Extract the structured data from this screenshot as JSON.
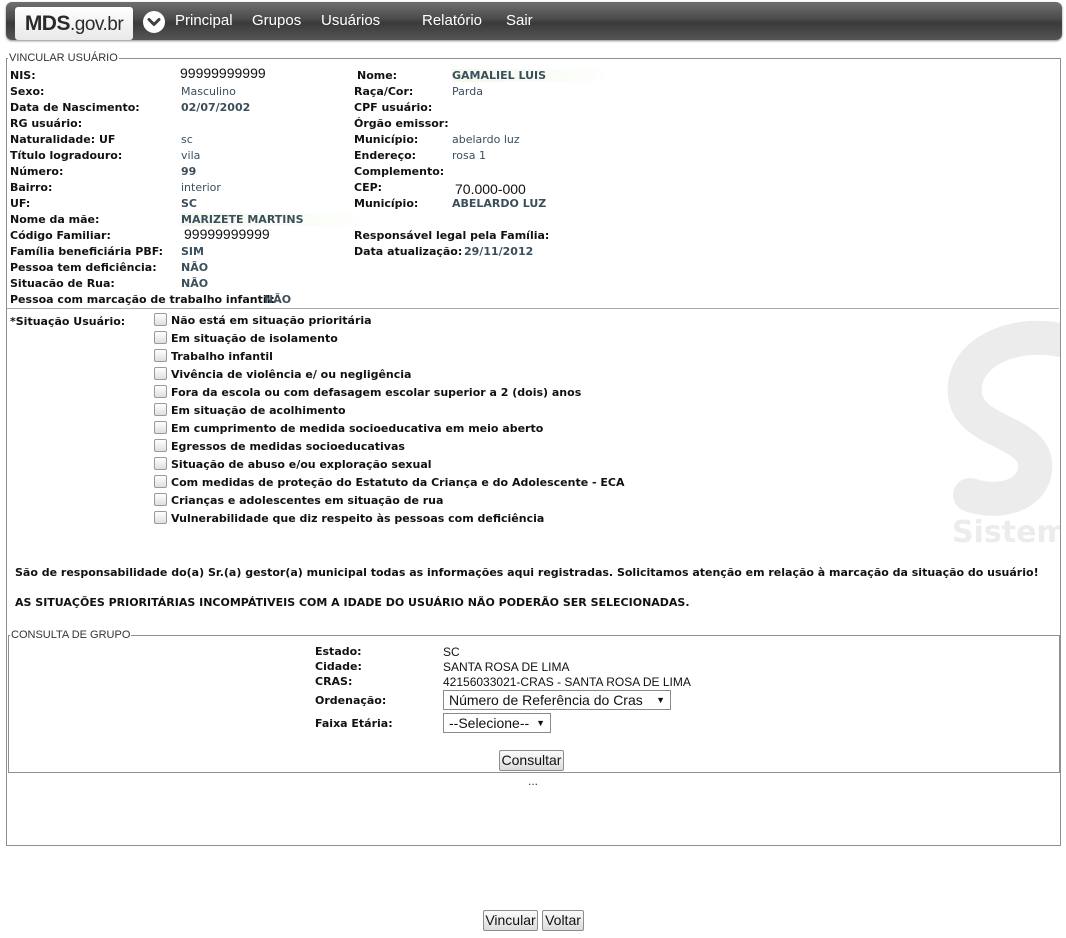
{
  "header": {
    "logo_bold": "MDS",
    "logo_rest": ".gov.br",
    "menu_icon": "chevron-down-circle-icon",
    "nav": [
      "Principal",
      "Grupos",
      "Usuários",
      "Relatório",
      "Sair"
    ]
  },
  "vincular": {
    "legend": "VINCULAR USUÁRIO",
    "watermark_text": "Sistema",
    "fields": {
      "nis": {
        "label": "NIS:",
        "value": "99999999999"
      },
      "nome": {
        "label": "Nome:",
        "value": "GAMALIEL LUIS"
      },
      "sexo": {
        "label": "Sexo:",
        "value": "Masculino"
      },
      "raca": {
        "label": "Raça/Cor:",
        "value": "Parda"
      },
      "nascimento": {
        "label": "Data de Nascimento:",
        "value": "02/07/2002"
      },
      "cpf": {
        "label": "CPF usuário:",
        "value": ""
      },
      "rg": {
        "label": "RG usuário:",
        "value": ""
      },
      "orgao": {
        "label": "Órgão emissor:",
        "value": ""
      },
      "naturalidade": {
        "label": "Naturalidade: UF",
        "value": "sc"
      },
      "municipio_nat": {
        "label": "Município:",
        "value": "abelardo luz"
      },
      "titulo": {
        "label": "Título logradouro:",
        "value": "vila"
      },
      "endereco": {
        "label": "Endereço:",
        "value": "rosa 1"
      },
      "numero": {
        "label": "Número:",
        "value": "99"
      },
      "complemento": {
        "label": "Complemento:",
        "value": ""
      },
      "bairro": {
        "label": "Bairro:",
        "value": "interior"
      },
      "cep": {
        "label": "CEP:",
        "value": "70.000-000"
      },
      "uf": {
        "label": "UF:",
        "value": "SC"
      },
      "municipio": {
        "label": "Município:",
        "value": "ABELARDO LUZ"
      },
      "mae": {
        "label": "Nome da mãe:",
        "value": "MARIZETE MARTINS"
      },
      "codigo": {
        "label": "Código Familiar:",
        "value": "99999999999"
      },
      "responsavel": {
        "label": "Responsável legal pela Família:",
        "value": ""
      },
      "pbf": {
        "label": "Família beneficiária PBF:",
        "value": "SIM"
      },
      "atualizacao": {
        "label": "Data atualização:",
        "value": "29/11/2012"
      },
      "deficiencia": {
        "label": "Pessoa tem deficiência:",
        "value": "NÃO"
      },
      "rua": {
        "label": "Situacão de Rua:",
        "value": "NÃO"
      },
      "trabalho": {
        "label": "Pessoa com marcação de trabalho infantil:",
        "value": "NÃO"
      }
    },
    "situacao_label": "*Situação Usuário:",
    "situacoes": [
      "Não está em situação prioritária",
      "Em situação de isolamento",
      "Trabalho infantil",
      "Vivência de violência e/ ou negligência",
      "Fora da escola ou com defasagem escolar superior a 2 (dois) anos",
      "Em situação de acolhimento",
      "Em cumprimento de medida socioeducativa em meio aberto",
      "Egressos de medidas socioeducativas",
      "Situação de abuso e/ou exploração sexual",
      "Com medidas de proteção do Estatuto da Criança e do Adolescente - ECA",
      "Crianças e adolescentes em situação de rua",
      "Vulnerabilidade que diz respeito às pessoas com deficiência"
    ],
    "notice1": "São de responsabilidade do(a) Sr.(a) gestor(a) municipal todas as informações aqui registradas. Solicitamos atenção em relação à marcação da situação do usuário!",
    "notice2": "AS SITUAÇÕES PRIORITÁRIAS INCOMPÁTIVEIS COM A IDADE DO USUÁRIO NÃO PODERÃO SER SELECIONADAS."
  },
  "grupo": {
    "legend": "CONSULTA DE GRUPO",
    "estado_label": "Estado:",
    "estado": "SC",
    "cidade_label": "Cidade:",
    "cidade": "SANTA ROSA DE LIMA",
    "cras_label": "CRAS:",
    "cras": "42156033021-CRAS - SANTA ROSA DE LIMA",
    "ordenacao_label": "Ordenação:",
    "ordenacao_value": "Número de Referência do Cras",
    "faixa_label": "Faixa Etária:",
    "faixa_value": "--Selecione--",
    "consultar": "Consultar",
    "ellipsis": "..."
  },
  "actions": {
    "vincular": "Vincular",
    "voltar": "Voltar"
  }
}
